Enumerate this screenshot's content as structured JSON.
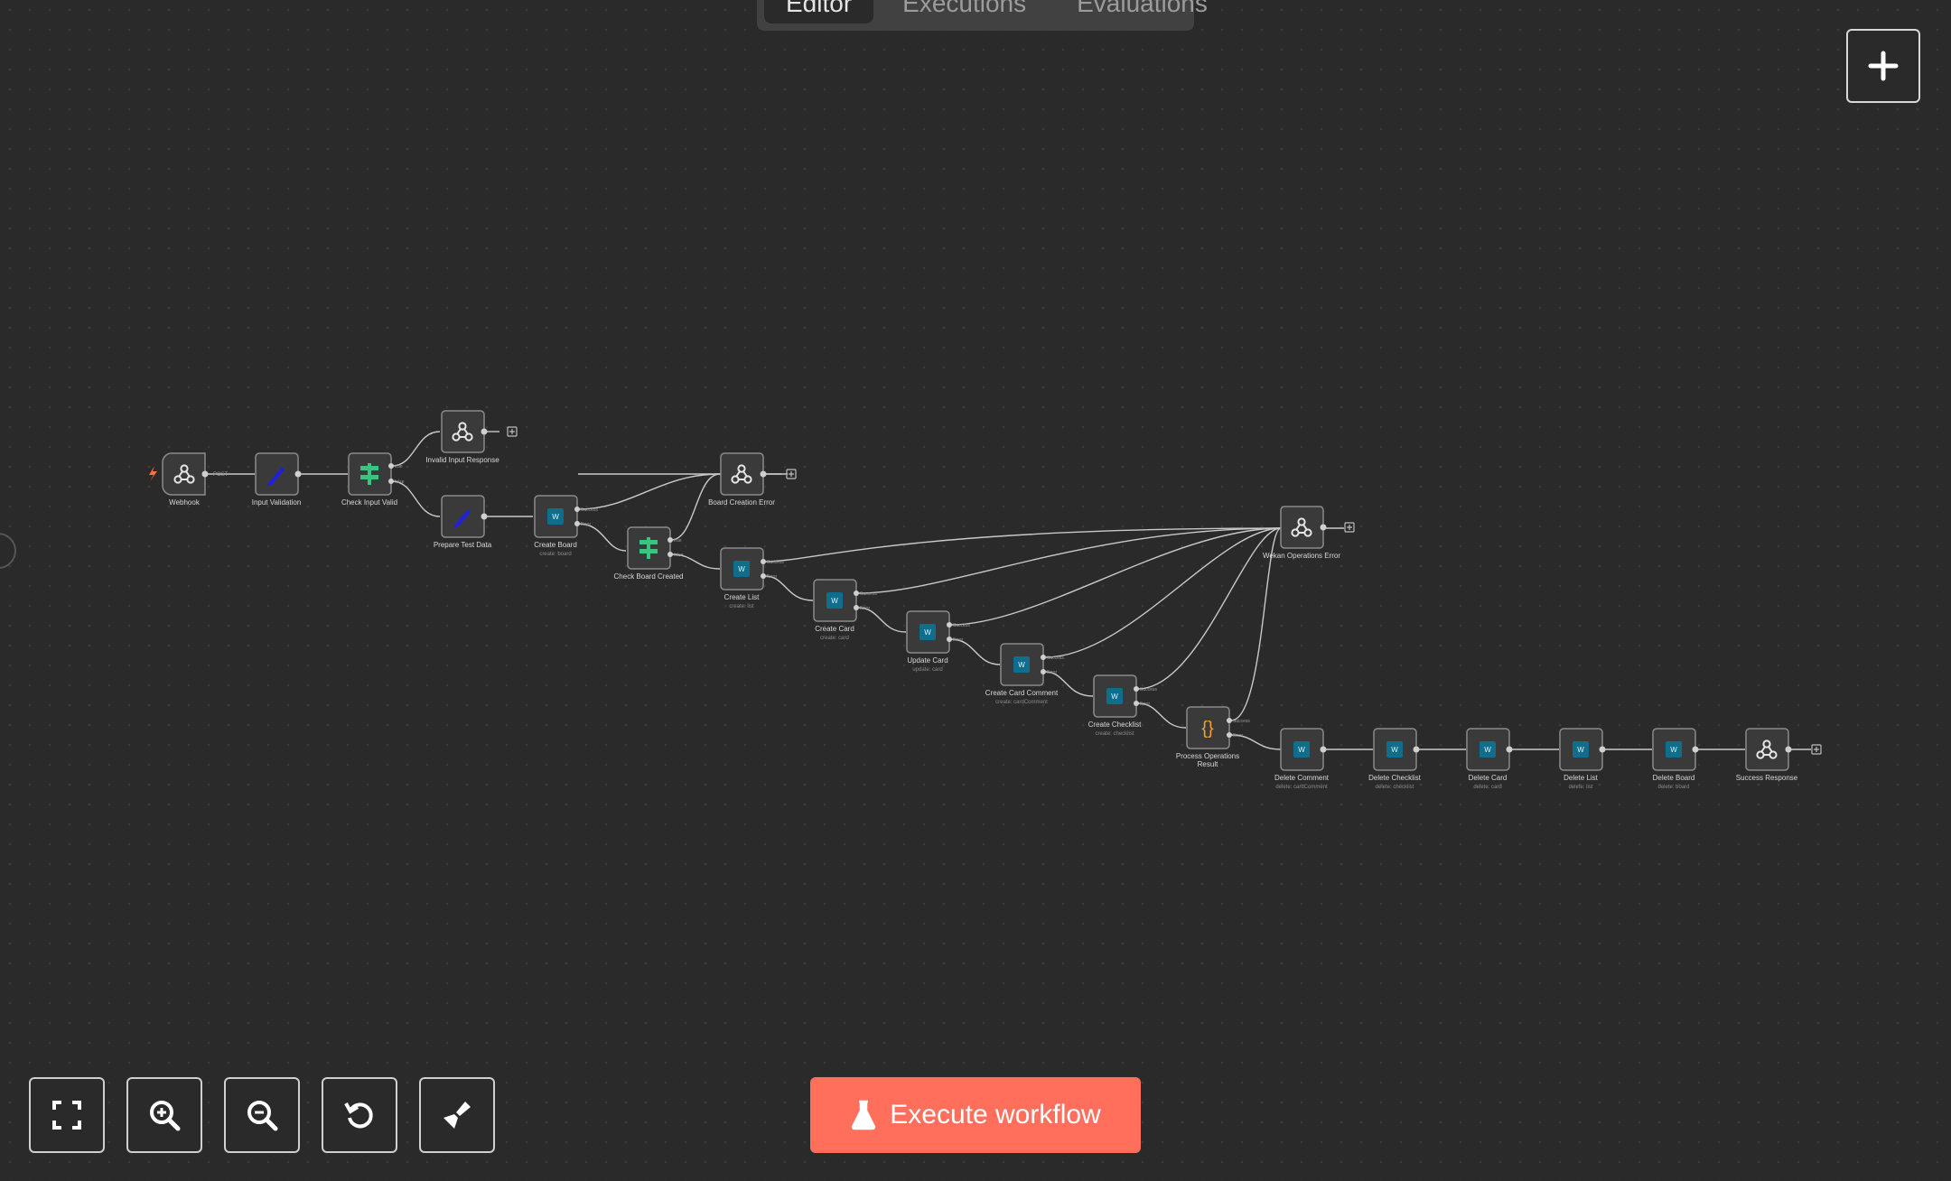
{
  "tabs": [
    {
      "label": "Editor",
      "active": true
    },
    {
      "label": "Executions",
      "active": false
    },
    {
      "label": "Evaluations",
      "active": false
    }
  ],
  "colors": {
    "canvas_bg": "#2a2a2a",
    "node_bg": "#3a3a3a",
    "node_border": "#8a8a8a",
    "edge": "#cfcfcf",
    "execute_button": "#ff6f5c",
    "if_icon": "#3ec27f",
    "set_icon": "#2020e0",
    "wekan_icon": "#0e6e8c",
    "code_icon": "#f0a030",
    "trigger_bolt": "#ff6f3c"
  },
  "nodes": {
    "webhook": {
      "title": "Webhook",
      "port_label": "POST",
      "icon": "webhook-icon"
    },
    "input_validation": {
      "title": "Input Validation",
      "icon": "pencil-icon"
    },
    "check_input_valid": {
      "title": "Check Input Valid",
      "icon": "if-icon",
      "outputs": [
        "true",
        "false"
      ]
    },
    "invalid_input_response": {
      "title": "Invalid Input Response",
      "icon": "webhook-icon"
    },
    "prepare_test_data": {
      "title": "Prepare Test Data",
      "icon": "pencil-icon"
    },
    "create_board": {
      "title": "Create Board",
      "subtitle": "create: board",
      "icon": "wekan-icon",
      "outputs": [
        "Success",
        "Error"
      ]
    },
    "check_board_created": {
      "title": "Check Board Created",
      "icon": "if-icon",
      "outputs": [
        "true",
        "false"
      ]
    },
    "board_creation_error": {
      "title": "Board Creation Error",
      "icon": "webhook-icon"
    },
    "create_list": {
      "title": "Create List",
      "subtitle": "create: list",
      "icon": "wekan-icon",
      "outputs": [
        "Success",
        "Error"
      ]
    },
    "create_card": {
      "title": "Create Card",
      "subtitle": "create: card",
      "icon": "wekan-icon",
      "outputs": [
        "Success",
        "Error"
      ]
    },
    "update_card": {
      "title": "Update Card",
      "subtitle": "update: card",
      "icon": "wekan-icon",
      "outputs": [
        "Success",
        "Error"
      ]
    },
    "create_card_comment": {
      "title": "Create Card Comment",
      "subtitle": "create: cardComment",
      "icon": "wekan-icon",
      "outputs": [
        "Success",
        "Error"
      ]
    },
    "create_checklist": {
      "title": "Create Checklist",
      "subtitle": "create: checklist",
      "icon": "wekan-icon",
      "outputs": [
        "Success",
        "Error"
      ]
    },
    "process_operations_result": {
      "title_line1": "Process Operations",
      "title_line2": "Result",
      "icon": "code-braces-icon",
      "outputs": [
        "Success",
        "Error"
      ]
    },
    "wekan_operations_error": {
      "title": "Wekan Operations Error",
      "icon": "webhook-icon"
    },
    "delete_comment": {
      "title": "Delete Comment",
      "subtitle": "delete: cardComment",
      "icon": "wekan-icon"
    },
    "delete_checklist": {
      "title": "Delete Checklist",
      "subtitle": "delete: checklist",
      "icon": "wekan-icon"
    },
    "delete_card": {
      "title": "Delete Card",
      "subtitle": "delete: card",
      "icon": "wekan-icon"
    },
    "delete_list": {
      "title": "Delete List",
      "subtitle": "delete: list",
      "icon": "wekan-icon"
    },
    "delete_board": {
      "title": "Delete Board",
      "subtitle": "delete: board",
      "icon": "wekan-icon"
    },
    "success_response": {
      "title": "Success Response",
      "icon": "webhook-icon"
    }
  },
  "toolbar": {
    "fit_view": "fit-view-icon",
    "zoom_in": "zoom-in-icon",
    "zoom_out": "zoom-out-icon",
    "reset_zoom": "reset-zoom-icon",
    "tidy_up": "broom-icon"
  },
  "execute_button": {
    "label": "Execute workflow",
    "icon": "flask-icon"
  }
}
